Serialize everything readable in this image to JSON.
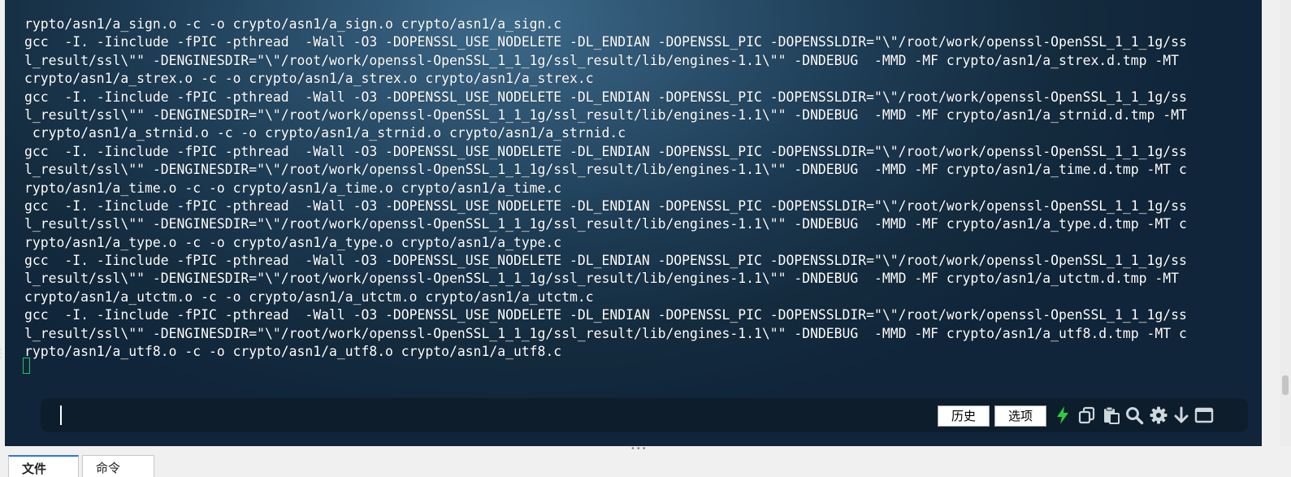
{
  "terminal": {
    "lines": [
      "rypto/asn1/a_sign.o -c -o crypto/asn1/a_sign.o crypto/asn1/a_sign.c",
      "gcc  -I. -Iinclude -fPIC -pthread  -Wall -O3 -DOPENSSL_USE_NODELETE -DL_ENDIAN -DOPENSSL_PIC -DOPENSSLDIR=\"\\\"/root/work/openssl-OpenSSL_1_1_1g/ss",
      "l_result/ssl\\\"\" -DENGINESDIR=\"\\\"/root/work/openssl-OpenSSL_1_1_1g/ssl_result/lib/engines-1.1\\\"\" -DNDEBUG  -MMD -MF crypto/asn1/a_strex.d.tmp -MT",
      "crypto/asn1/a_strex.o -c -o crypto/asn1/a_strex.o crypto/asn1/a_strex.c",
      "gcc  -I. -Iinclude -fPIC -pthread  -Wall -O3 -DOPENSSL_USE_NODELETE -DL_ENDIAN -DOPENSSL_PIC -DOPENSSLDIR=\"\\\"/root/work/openssl-OpenSSL_1_1_1g/ss",
      "l_result/ssl\\\"\" -DENGINESDIR=\"\\\"/root/work/openssl-OpenSSL_1_1_1g/ssl_result/lib/engines-1.1\\\"\" -DNDEBUG  -MMD -MF crypto/asn1/a_strnid.d.tmp -MT",
      " crypto/asn1/a_strnid.o -c -o crypto/asn1/a_strnid.o crypto/asn1/a_strnid.c",
      "gcc  -I. -Iinclude -fPIC -pthread  -Wall -O3 -DOPENSSL_USE_NODELETE -DL_ENDIAN -DOPENSSL_PIC -DOPENSSLDIR=\"\\\"/root/work/openssl-OpenSSL_1_1_1g/ss",
      "l_result/ssl\\\"\" -DENGINESDIR=\"\\\"/root/work/openssl-OpenSSL_1_1_1g/ssl_result/lib/engines-1.1\\\"\" -DNDEBUG  -MMD -MF crypto/asn1/a_time.d.tmp -MT c",
      "rypto/asn1/a_time.o -c -o crypto/asn1/a_time.o crypto/asn1/a_time.c",
      "gcc  -I. -Iinclude -fPIC -pthread  -Wall -O3 -DOPENSSL_USE_NODELETE -DL_ENDIAN -DOPENSSL_PIC -DOPENSSLDIR=\"\\\"/root/work/openssl-OpenSSL_1_1_1g/ss",
      "l_result/ssl\\\"\" -DENGINESDIR=\"\\\"/root/work/openssl-OpenSSL_1_1_1g/ssl_result/lib/engines-1.1\\\"\" -DNDEBUG  -MMD -MF crypto/asn1/a_type.d.tmp -MT c",
      "rypto/asn1/a_type.o -c -o crypto/asn1/a_type.o crypto/asn1/a_type.c",
      "gcc  -I. -Iinclude -fPIC -pthread  -Wall -O3 -DOPENSSL_USE_NODELETE -DL_ENDIAN -DOPENSSL_PIC -DOPENSSLDIR=\"\\\"/root/work/openssl-OpenSSL_1_1_1g/ss",
      "l_result/ssl\\\"\" -DENGINESDIR=\"\\\"/root/work/openssl-OpenSSL_1_1_1g/ssl_result/lib/engines-1.1\\\"\" -DNDEBUG  -MMD -MF crypto/asn1/a_utctm.d.tmp -MT",
      "crypto/asn1/a_utctm.o -c -o crypto/asn1/a_utctm.o crypto/asn1/a_utctm.c",
      "gcc  -I. -Iinclude -fPIC -pthread  -Wall -O3 -DOPENSSL_USE_NODELETE -DL_ENDIAN -DOPENSSL_PIC -DOPENSSLDIR=\"\\\"/root/work/openssl-OpenSSL_1_1_1g/ss",
      "l_result/ssl\\\"\" -DENGINESDIR=\"\\\"/root/work/openssl-OpenSSL_1_1_1g/ssl_result/lib/engines-1.1\\\"\" -DNDEBUG  -MMD -MF crypto/asn1/a_utf8.d.tmp -MT c",
      "rypto/asn1/a_utf8.o -c -o crypto/asn1/a_utf8.o crypto/asn1/a_utf8.c"
    ],
    "cursor_color": "#1fc36a"
  },
  "command_bar": {
    "input_value": "",
    "history_label": "历史",
    "options_label": "选项",
    "icons": [
      "lightning-icon",
      "copy-icon",
      "paste-icon",
      "search-icon",
      "gear-icon",
      "arrow-down-icon",
      "window-icon"
    ],
    "lightning_color": "#2ecc40"
  },
  "tabs": [
    {
      "label": "文件",
      "active": true
    },
    {
      "label": "命令",
      "active": false
    }
  ]
}
